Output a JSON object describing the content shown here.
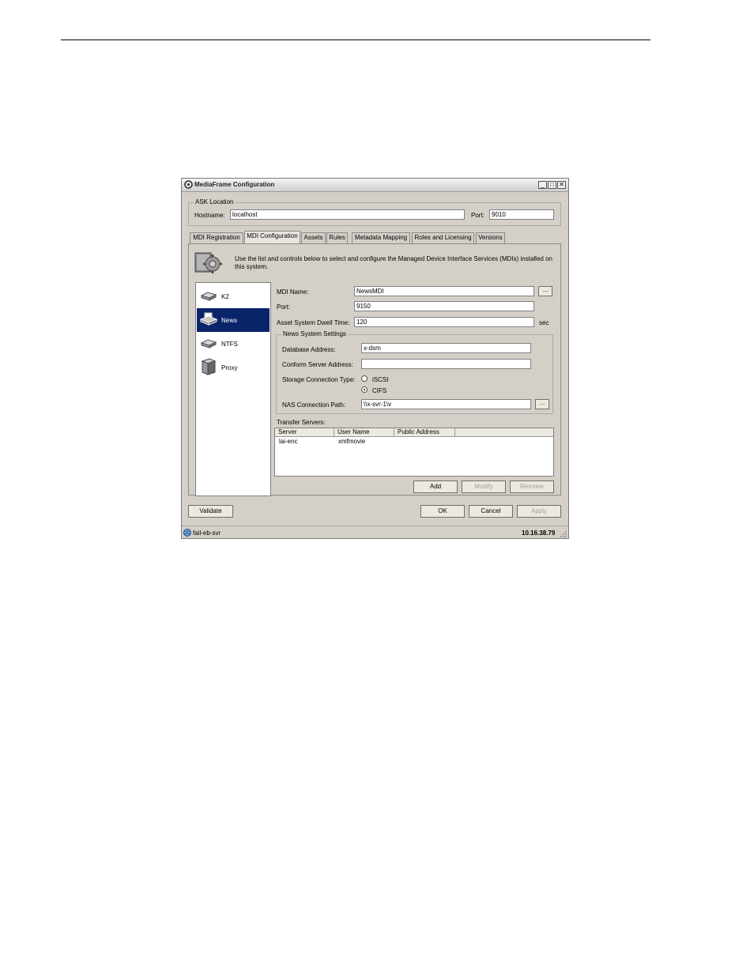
{
  "window": {
    "title": "MediaFrame Configuration",
    "minimize": "_",
    "maximize": "□",
    "close": "✕"
  },
  "ask_location": {
    "legend": "ASK Location",
    "hostname_label": "Hostname:",
    "hostname_value": "localhost",
    "port_label": "Port:",
    "port_value": "9010"
  },
  "tabs": [
    "MDI Registration",
    "MDI Configuration",
    "Assets",
    "Rules",
    "Metadata Mapping",
    "Roles and Licensing",
    "Versions"
  ],
  "active_tab": "MDI Configuration",
  "intro_text": "Use the list and controls below to select and configure the Managed Device Interface Services (MDIs) installed on this system.",
  "mdi_list": [
    {
      "label": "K2",
      "icon": "drive-icon",
      "selected": false
    },
    {
      "label": "News",
      "icon": "printer-icon",
      "selected": true
    },
    {
      "label": "NTFS",
      "icon": "drive-icon",
      "selected": false
    },
    {
      "label": "Proxy",
      "icon": "server-icon",
      "selected": false
    }
  ],
  "form": {
    "mdi_name_label": "MDI Name:",
    "mdi_name_value": "NewsMDI",
    "port_label": "Port:",
    "port_value": "9150",
    "dwell_label": "Asset System Dwell Time:",
    "dwell_value": "120",
    "dwell_unit": "sec",
    "browse": "..."
  },
  "news_settings": {
    "legend": "News System Settings",
    "db_label": "Database Address:",
    "db_value": "x-dsm",
    "conform_label": "Conform Server Address:",
    "conform_value": "",
    "storage_label": "Storage Connection Type:",
    "iscsi": "iSCSI",
    "cifs": "CIFS",
    "nas_label": "NAS Connection Path:",
    "nas_value": "\\\\x-svr-1\\v",
    "browse": "..."
  },
  "transfer": {
    "label": "Transfer Servers:",
    "columns": [
      "Server",
      "User Name",
      "Public Address"
    ],
    "rows": [
      {
        "server": "lai-enc",
        "user": "xmfmovie",
        "address": ""
      }
    ],
    "add": "Add",
    "modify": "Modify",
    "remove": "Remove"
  },
  "buttons": {
    "validate": "Validate",
    "ok": "OK",
    "cancel": "Cancel",
    "apply": "Apply"
  },
  "status": {
    "left": "fail-eb-svr",
    "right": "10.16.38.79"
  }
}
